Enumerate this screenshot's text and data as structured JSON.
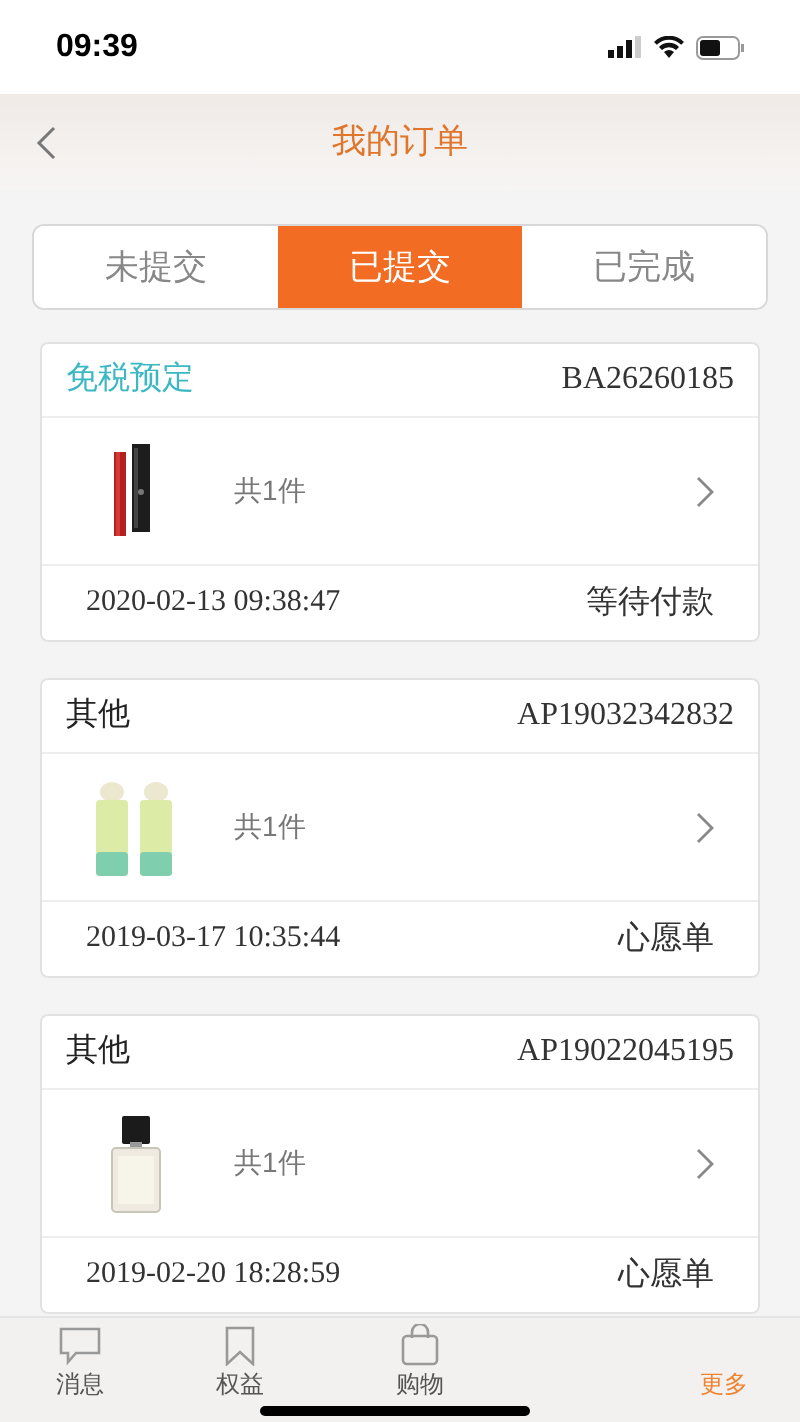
{
  "status_bar": {
    "time": "09:39"
  },
  "header": {
    "title": "我的订单"
  },
  "tabs": [
    {
      "label": "未提交",
      "selected": false
    },
    {
      "label": "已提交",
      "selected": true
    },
    {
      "label": "已完成",
      "selected": false
    }
  ],
  "orders": [
    {
      "type": "免税预定",
      "color": "#3bb8c2",
      "number": "BA26260185",
      "count": "共1件",
      "time": "2020-02-13 09:38:47",
      "status": "等待付款"
    },
    {
      "type": "其他",
      "color": "#222222",
      "number": "AP19032342832",
      "count": "共1件",
      "time": "2019-03-17 10:35:44",
      "status": "心愿单"
    },
    {
      "type": "其他",
      "color": "#222222",
      "number": "AP19022045195",
      "count": "共1件",
      "time": "2019-02-20 18:28:59",
      "status": "心愿单"
    }
  ],
  "tab_bar": [
    {
      "label": "消息",
      "selected": false
    },
    {
      "label": "权益",
      "selected": false
    },
    {
      "label": "购物",
      "selected": false
    },
    {
      "label": "更多",
      "selected": true
    }
  ]
}
